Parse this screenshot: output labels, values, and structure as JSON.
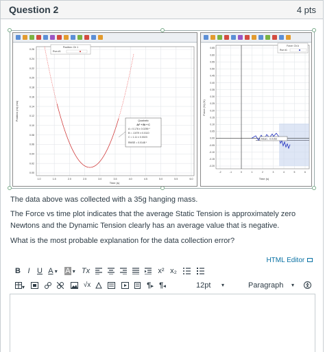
{
  "question": {
    "title": "Question 2",
    "points": "4 pts"
  },
  "figure": {
    "left_graph": {
      "legend_title": "Position: Ch 1",
      "legend_run": "Run #1",
      "y_axis_label": "Position (m) (ms)",
      "x_axis_label": "Time (s)",
      "y_ticks": [
        "0.26",
        "0.24",
        "0.22",
        "0.20",
        "0.18",
        "0.16",
        "0.14",
        "0.12",
        "0.10",
        "0.08",
        "0.06",
        "0.04",
        "0.02",
        "0.00"
      ],
      "x_ticks": [
        "1.0",
        "1.5",
        "2.0",
        "2.5",
        "3.0",
        "3.5",
        "4.0",
        "4.5",
        "5.0",
        "5.5",
        "6.0"
      ],
      "fit_box": {
        "title": "Quadratic",
        "formula": "At² + Bt + C",
        "lines": [
          "A = 0.176 ± 0.0259 *",
          "B = -0.879 ± 0.0110",
          "C = 1.11 ± 0.0023",
          "RMSE = 0.0148 *"
        ]
      }
    },
    "right_graph": {
      "legend_title": "Force: Ch A",
      "legend_run": "Run #1",
      "y_axis_label": "Force (N) (N)",
      "x_axis_label": "Time (s)",
      "y_ticks": [
        "0.65",
        "0.60",
        "0.55",
        "0.50",
        "0.45",
        "0.40",
        "0.35",
        "0.30",
        "0.25",
        "0.20",
        "0.15",
        "0.10",
        "0.05",
        "0.00",
        "-0.05",
        "-0.10",
        "-0.15",
        "-0.20"
      ],
      "x_ticks": [
        "-2",
        "-1",
        "0",
        "1",
        "2",
        "3",
        "4",
        "5",
        "6"
      ],
      "mean_label": "Mean : -0.0153"
    }
  },
  "text": {
    "p1": "The data above was collected with a 35g hanging mass.",
    "p2": "The Force vs time plot indicates that the average Static Tension is approximately zero Newtons and the Dynamic Tension clearly has an average value that is negative.",
    "p3": "What is the most probable explanation for the data collection error?"
  },
  "editor": {
    "html_editor_link": "HTML Editor",
    "font_size": "12pt",
    "paragraph": "Paragraph",
    "toolbar_row1": [
      "B",
      "I",
      "U",
      "A",
      "A",
      "Tx",
      "align-left",
      "align-center",
      "align-right",
      "align-justify",
      "indent",
      "x²",
      "x₂",
      "bullet-list",
      "numbered-list"
    ],
    "toolbar_row2": [
      "table",
      "media",
      "link",
      "unlink",
      "image",
      "equation",
      "sqrt",
      "embed",
      "record",
      "document",
      "ltr",
      "rtl",
      "12pt",
      "Paragraph",
      "accessibility"
    ]
  }
}
